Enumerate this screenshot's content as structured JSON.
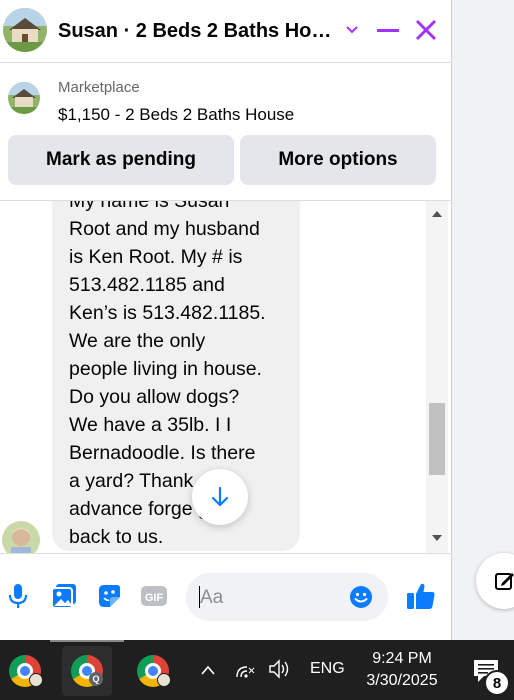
{
  "header": {
    "title": "Susan · 2 Beds 2 Baths Ho…",
    "accent_color": "#a033ff"
  },
  "marketplace": {
    "label": "Marketplace",
    "listing": "$1,150 - 2 Beds 2 Baths House",
    "mark_pending_label": "Mark as pending",
    "more_options_label": "More options"
  },
  "message": {
    "text": "My name is Susan\nRoot and my husband\nis Ken Root. My # is\n513.482.1185 and\nKen’s is 513.482.1185.\nWe are the only\npeople living in house.\nDo you allow dogs?\nWe have a 35lb. I I\nBernadoodle. Is there\na yard?  Thank\nadvance forge     g\nback to us."
  },
  "composer": {
    "placeholder": "Aa",
    "value": "",
    "icons": [
      "microphone-icon",
      "photo-icon",
      "sticker-icon",
      "gif-icon",
      "emoji-icon",
      "thumbs-up-icon"
    ],
    "gif_label": "GIF"
  },
  "taskbar": {
    "apps": [
      "chrome-icon",
      "chrome-profile-q-icon",
      "chrome-icon"
    ],
    "profile_letter": "Q",
    "language": "ENG",
    "time": "9:24 PM",
    "date": "3/30/2025",
    "notification_count": "8"
  },
  "colors": {
    "messenger_blue": "#0a7cff",
    "bubble_gray": "#f0f0f0",
    "button_gray": "#e4e6eb"
  }
}
